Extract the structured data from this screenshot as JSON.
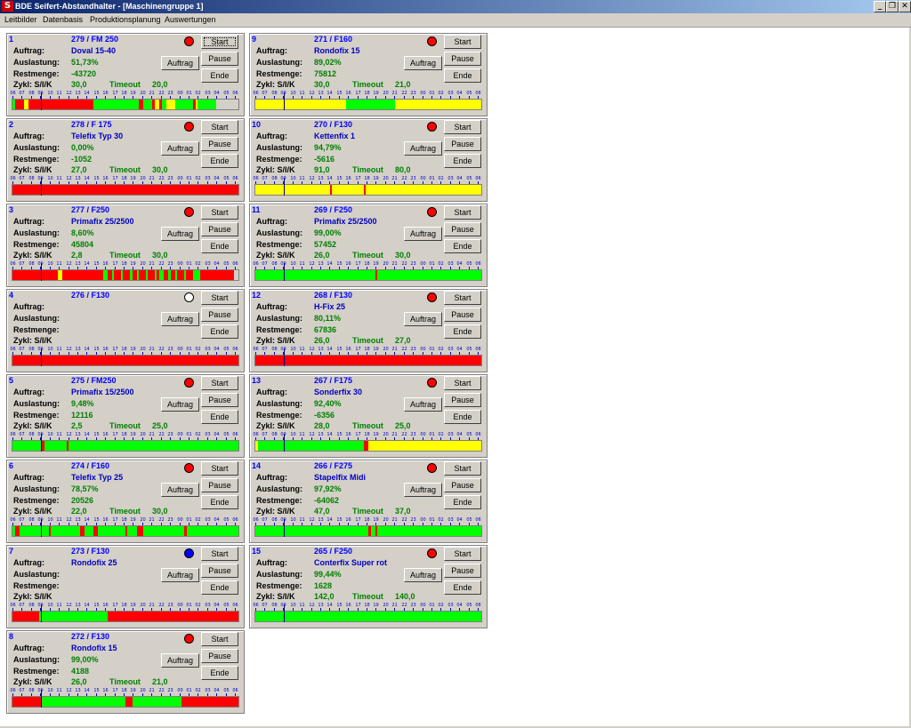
{
  "window": {
    "title": "BDE Seifert-Abstandhalter - [Maschinengruppe 1]",
    "controls": {
      "minimize": "_",
      "restore": "❐",
      "close": "✕"
    }
  },
  "menu": {
    "items": [
      "Leitbilder",
      "Datenbasis",
      "Produktionsplanung",
      "Auswertungen"
    ]
  },
  "labels": {
    "auftrag": "Auftrag:",
    "auslastung": "Auslastung:",
    "restmenge": "Restmenge:",
    "zykl": "Zykl: S/I/K",
    "timeout": "Timeout",
    "btn_start": "Start",
    "btn_pause": "Pause",
    "btn_ende": "Ende",
    "btn_auftrag": "Auftrag"
  },
  "timeline_ticks": [
    "06",
    "07",
    "08",
    "09",
    "10",
    "11",
    "12",
    "13",
    "14",
    "15",
    "16",
    "17",
    "18",
    "19",
    "20",
    "21",
    "22",
    "23",
    "00",
    "01",
    "02",
    "03",
    "04",
    "05",
    "06"
  ],
  "colors": {
    "red": "#ff0000",
    "green": "#00ff00",
    "yellow": "#ffff00",
    "blue": "#0000ff",
    "empty": "#ffffff",
    "dark_red": "#c00000"
  },
  "machines": [
    {
      "num": "1",
      "title": "279 / FM 250",
      "auftrag": "Doval 15-40",
      "auslastung": "51,73%",
      "restmenge": "-43720",
      "zykl": "30,0",
      "timeout": "20,0",
      "status": "red",
      "timeline": [
        [
          "green",
          1
        ],
        [
          "red",
          4
        ],
        [
          "yellow",
          2
        ],
        [
          "red",
          29
        ],
        [
          "green",
          20
        ],
        [
          "red",
          2
        ],
        [
          "green",
          4
        ],
        [
          "red",
          1
        ],
        [
          "yellow",
          2
        ],
        [
          "red",
          1
        ],
        [
          "green",
          2
        ],
        [
          "yellow",
          4
        ],
        [
          "green",
          8
        ],
        [
          "red",
          1
        ],
        [
          "yellow",
          1
        ],
        [
          "green",
          8
        ]
      ]
    },
    {
      "num": "2",
      "title": "278 / F 175",
      "auftrag": "Telefix Typ 30",
      "auslastung": "0,00%",
      "restmenge": "-1052",
      "zykl": "27,0",
      "timeout": "30,0",
      "status": "red",
      "timeline": [
        [
          "red",
          100
        ]
      ]
    },
    {
      "num": "3",
      "title": "277 / F250",
      "auftrag": "Primafix 25/2500",
      "auslastung": "8,60%",
      "restmenge": "45804",
      "zykl": "2,8",
      "timeout": "30,0",
      "status": "red",
      "timeline": [
        [
          "red",
          20
        ],
        [
          "yellow",
          2
        ],
        [
          "red",
          18
        ],
        [
          "green",
          2
        ],
        [
          "red",
          2
        ],
        [
          "green",
          1
        ],
        [
          "red",
          3
        ],
        [
          "green",
          1
        ],
        [
          "red",
          3
        ],
        [
          "green",
          1
        ],
        [
          "red",
          2
        ],
        [
          "green",
          1
        ],
        [
          "red",
          3
        ],
        [
          "green",
          1
        ],
        [
          "red",
          3
        ],
        [
          "green",
          1
        ],
        [
          "red",
          1
        ],
        [
          "green",
          2
        ],
        [
          "red",
          2
        ],
        [
          "green",
          1
        ],
        [
          "red",
          2
        ],
        [
          "green",
          1
        ],
        [
          "red",
          3
        ],
        [
          "green",
          1
        ],
        [
          "red",
          3
        ],
        [
          "green",
          3
        ],
        [
          "red",
          15
        ]
      ]
    },
    {
      "num": "4",
      "title": "276 / F130",
      "auftrag": "",
      "auslastung": "",
      "restmenge": "",
      "zykl": "",
      "timeout": "",
      "status": "empty",
      "timeline": [
        [
          "red",
          100
        ]
      ]
    },
    {
      "num": "5",
      "title": "275 / FM250",
      "auftrag": "Primafix 15/2500",
      "auslastung": "9,48%",
      "restmenge": "12116",
      "zykl": "2,5",
      "timeout": "25,0",
      "status": "red",
      "timeline": [
        [
          "green",
          13
        ],
        [
          "red",
          1
        ],
        [
          "green",
          10
        ],
        [
          "red",
          1
        ],
        [
          "green",
          75
        ]
      ]
    },
    {
      "num": "6",
      "title": "274 / F160",
      "auftrag": "Telefix Typ 25",
      "auslastung": "78,57%",
      "restmenge": "20526",
      "zykl": "22,0",
      "timeout": "30,0",
      "status": "red",
      "timeline": [
        [
          "green",
          1
        ],
        [
          "red",
          2
        ],
        [
          "green",
          13
        ],
        [
          "red",
          1
        ],
        [
          "green",
          13
        ],
        [
          "red",
          2
        ],
        [
          "green",
          4
        ],
        [
          "red",
          2
        ],
        [
          "green",
          12
        ],
        [
          "red",
          1
        ],
        [
          "green",
          4
        ],
        [
          "red",
          3
        ],
        [
          "green",
          18
        ],
        [
          "red",
          1
        ],
        [
          "green",
          23
        ]
      ]
    },
    {
      "num": "7",
      "title": "273 / F130",
      "auftrag": "Rondofix 25",
      "auslastung": "",
      "restmenge": "",
      "zykl": "",
      "timeout": "",
      "status": "blue",
      "timeline": [
        [
          "red",
          12
        ],
        [
          "green",
          30
        ],
        [
          "red",
          58
        ]
      ]
    },
    {
      "num": "8",
      "title": "272 / F130",
      "auftrag": "Rondofix 15",
      "auslastung": "99,00%",
      "restmenge": "4188",
      "zykl": "26,0",
      "timeout": "21,0",
      "status": "red",
      "timeline": [
        [
          "red",
          13
        ],
        [
          "green",
          37
        ],
        [
          "red",
          3
        ],
        [
          "green",
          22
        ],
        [
          "red",
          25
        ]
      ]
    },
    {
      "num": "9",
      "title": "271 / F160",
      "auftrag": "Rondofix 15",
      "auslastung": "89,02%",
      "restmenge": "75812",
      "zykl": "30,0",
      "timeout": "21,0",
      "status": "red",
      "timeline": [
        [
          "yellow",
          40
        ],
        [
          "green",
          22
        ],
        [
          "yellow",
          38
        ]
      ]
    },
    {
      "num": "10",
      "title": "270 / F130",
      "auftrag": "Kettenfix 1",
      "auslastung": "94,79%",
      "restmenge": "-5616",
      "zykl": "91,0",
      "timeout": "80,0",
      "status": "red",
      "timeline": [
        [
          "yellow",
          33
        ],
        [
          "red",
          1
        ],
        [
          "yellow",
          14
        ],
        [
          "red",
          1
        ],
        [
          "yellow",
          51
        ]
      ]
    },
    {
      "num": "11",
      "title": "269 / F250",
      "auftrag": "Primafix 25/2500",
      "auslastung": "99,00%",
      "restmenge": "57452",
      "zykl": "26,0",
      "timeout": "30,0",
      "status": "red",
      "timeline": [
        [
          "green",
          53
        ],
        [
          "red",
          1
        ],
        [
          "green",
          46
        ]
      ]
    },
    {
      "num": "12",
      "title": "268 / F130",
      "auftrag": "H-Fix 25",
      "auslastung": "80,11%",
      "restmenge": "67836",
      "zykl": "26,0",
      "timeout": "27,0",
      "status": "red",
      "timeline": [
        [
          "red",
          100
        ]
      ]
    },
    {
      "num": "13",
      "title": "267 / F175",
      "auftrag": "Sonderfix 30",
      "auslastung": "92,40%",
      "restmenge": "-6356",
      "zykl": "28,0",
      "timeout": "25,0",
      "status": "red",
      "timeline": [
        [
          "yellow",
          1
        ],
        [
          "green",
          47
        ],
        [
          "red",
          2
        ],
        [
          "yellow",
          50
        ]
      ]
    },
    {
      "num": "14",
      "title": "266 / F275",
      "auftrag": "Stapelfix Midi",
      "auslastung": "97,92%",
      "restmenge": "-64062",
      "zykl": "47,0",
      "timeout": "37,0",
      "status": "red",
      "timeline": [
        [
          "green",
          50
        ],
        [
          "red",
          1
        ],
        [
          "green",
          2
        ],
        [
          "red",
          1
        ],
        [
          "green",
          46
        ]
      ]
    },
    {
      "num": "15",
      "title": "265 / F250",
      "auftrag": "Conterfix Super rot",
      "auslastung": "99,44%",
      "restmenge": "1628",
      "zykl": "142,0",
      "timeout": "140,0",
      "status": "red",
      "timeline": [
        [
          "green",
          100
        ]
      ]
    }
  ]
}
